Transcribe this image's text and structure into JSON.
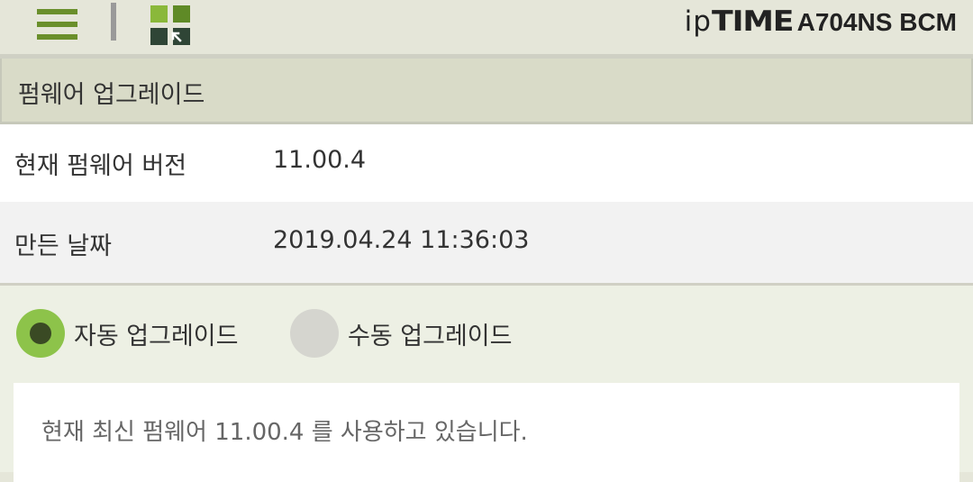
{
  "header": {
    "menu_icon": "hamburger-menu-icon",
    "apps_icon": "grid-apps-icon",
    "brand_prefix": "ip",
    "brand_name": "TIME",
    "model": "A704NS BCM",
    "colors": {
      "menu": "#6a8f2b",
      "apps_light": "#8ab83a",
      "apps_mid": "#5f8a26",
      "apps_dark": "#2f4536"
    }
  },
  "section": {
    "title": "펌웨어 업그레이드"
  },
  "info": {
    "rows": [
      {
        "label": "현재 펌웨어 버전",
        "value": "11.00.4"
      },
      {
        "label": "만든 날짜",
        "value": "2019.04.24 11:36:03"
      }
    ]
  },
  "upgrade": {
    "options": [
      {
        "label": "자동 업그레이드",
        "selected": true
      },
      {
        "label": "수동 업그레이드",
        "selected": false
      }
    ],
    "message": "현재 최신 펌웨어 11.00.4 를 사용하고 있습니다.",
    "colors": {
      "selected": "#8dc34a",
      "unselected": "#d5d5cf",
      "dot": "#3a4a24"
    }
  }
}
